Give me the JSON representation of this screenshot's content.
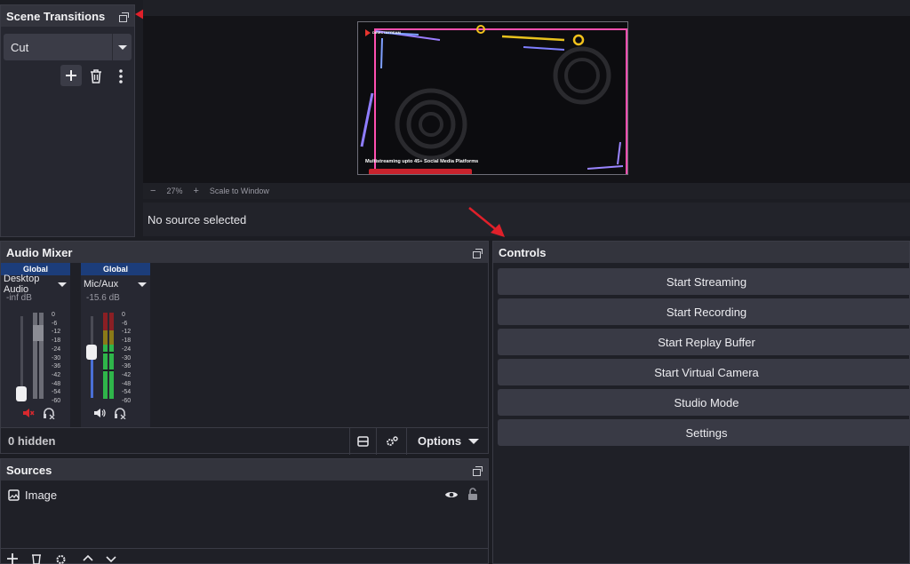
{
  "scene_transitions": {
    "title": "Scene Transitions",
    "selected": "Cut"
  },
  "preview": {
    "brand": "DIRECTSTREAM",
    "caption": "Multistreaming upto 45+ Social Media Platforms",
    "zoom_minus": "−",
    "zoom_value": "27%",
    "zoom_plus": "+",
    "scale_label": "Scale to Window"
  },
  "properties": {
    "no_source": "No source selected"
  },
  "audio_mixer": {
    "title": "Audio Mixer",
    "channels": [
      {
        "global": "Global",
        "name": "Desktop Audio",
        "db": "-inf dB"
      },
      {
        "global": "Global",
        "name": "Mic/Aux",
        "db": "-15.6 dB"
      }
    ],
    "scale": [
      "0",
      "-6",
      "-12",
      "-18",
      "-24",
      "-30",
      "-36",
      "-42",
      "-48",
      "-54",
      "-60"
    ],
    "hidden": "0 hidden",
    "options": "Options"
  },
  "sources": {
    "title": "Sources",
    "items": [
      {
        "name": "Image"
      }
    ]
  },
  "controls": {
    "title": "Controls",
    "buttons": [
      "Start Streaming",
      "Start Recording",
      "Start Replay Buffer",
      "Start Virtual Camera",
      "Studio Mode",
      "Settings"
    ]
  },
  "colors": {
    "accent_blue": "#1c3d7a",
    "annotation_red": "#e0202a",
    "meter_green": "#2fb54a",
    "meter_yellow": "#d8b516",
    "meter_red": "#c0282c",
    "fader_blue": "#4a6fd6"
  }
}
